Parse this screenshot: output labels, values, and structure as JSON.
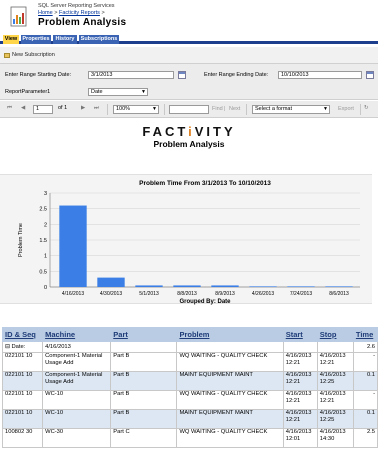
{
  "header": {
    "service": "SQL Server Reporting Services",
    "breadcrumb_home": "Home",
    "breadcrumb_sep": " > ",
    "breadcrumb_folder": "Facticity Reports",
    "breadcrumb_end": " >",
    "title": "Problem  Analysis"
  },
  "tabs": [
    {
      "label": "View",
      "active": true
    },
    {
      "label": "Properties",
      "active": false
    },
    {
      "label": "History",
      "active": false
    },
    {
      "label": "Subscriptions",
      "active": false
    }
  ],
  "toolbar_sub": {
    "new_subscription": "New Subscription"
  },
  "params": {
    "start_label": "Enter Range Starting Date:",
    "start_value": "3/1/2013",
    "end_label": "Enter Range Ending Date:",
    "end_value": "10/10/2013",
    "p1_label": "ReportParameter1",
    "p1_value": "Date"
  },
  "viewer": {
    "page": "1",
    "of": "of 1",
    "zoom": "100%",
    "find": "Find",
    "sep": "|",
    "next": "Next",
    "format": "Select a format",
    "export": "Export"
  },
  "report": {
    "logo_pre": "FACT",
    "logo_i": "i",
    "logo_post": "VITY",
    "title": "Problem Analysis"
  },
  "chart_data": {
    "type": "bar",
    "title": "Problem Time From 3/1/2013 To 10/10/2013",
    "xlabel": "Grouped By: Date",
    "ylabel": "Problem Time",
    "ylim": [
      0,
      3
    ],
    "yticks": [
      "0",
      "0.5",
      "1",
      "1.5",
      "2",
      "2.5",
      "3"
    ],
    "categories": [
      "4/16/2013",
      "4/30/2013",
      "5/1/2013",
      "8/8/2013",
      "8/9/2013",
      "4/26/2013",
      "7/24/2013",
      "8/6/2013"
    ],
    "values": [
      2.6,
      0.3,
      0.05,
      0.05,
      0.05,
      0.02,
      0.02,
      0.02
    ],
    "bar_color": "#3b7fe6",
    "grid": true
  },
  "table": {
    "headers": [
      "ID & Seq",
      "Machine",
      "Part",
      "Problem",
      "Start",
      "Stop",
      "Time"
    ],
    "group": {
      "label": "⊟ Date:",
      "value": "4/16/2013",
      "total": "2.6"
    },
    "rows": [
      {
        "id": "022101 10",
        "machine": "Component-1 Material Usage Add",
        "part": "Part B",
        "problem": "WQ WAITING - QUALITY CHECK",
        "start": "4/16/2013 12:21",
        "stop": "4/16/2013 12:21",
        "time": "-"
      },
      {
        "id": "022101 10",
        "machine": "Component-1 Material Usage Add",
        "part": "Part B",
        "problem": "MAINT EQUIPMENT MAINT",
        "start": "4/16/2013 12:21",
        "stop": "4/16/2013 12:25",
        "time": "0.1"
      },
      {
        "id": "022101 10",
        "machine": "WC-10",
        "part": "Part B",
        "problem": "WQ WAITING - QUALITY CHECK",
        "start": "4/16/2013 12:21",
        "stop": "4/16/2013 12:21",
        "time": "-"
      },
      {
        "id": "022101 10",
        "machine": "WC-10",
        "part": "Part B",
        "problem": "MAINT EQUIPMENT MAINT",
        "start": "4/16/2013 12:21",
        "stop": "4/16/2013 12:25",
        "time": "0.1"
      },
      {
        "id": "100802 30",
        "machine": "WC-30",
        "part": "Part C",
        "problem": "WQ WAITING - QUALITY CHECK",
        "start": "4/16/2013 12:01",
        "stop": "4/16/2013 14:30",
        "time": "2.5"
      }
    ]
  }
}
